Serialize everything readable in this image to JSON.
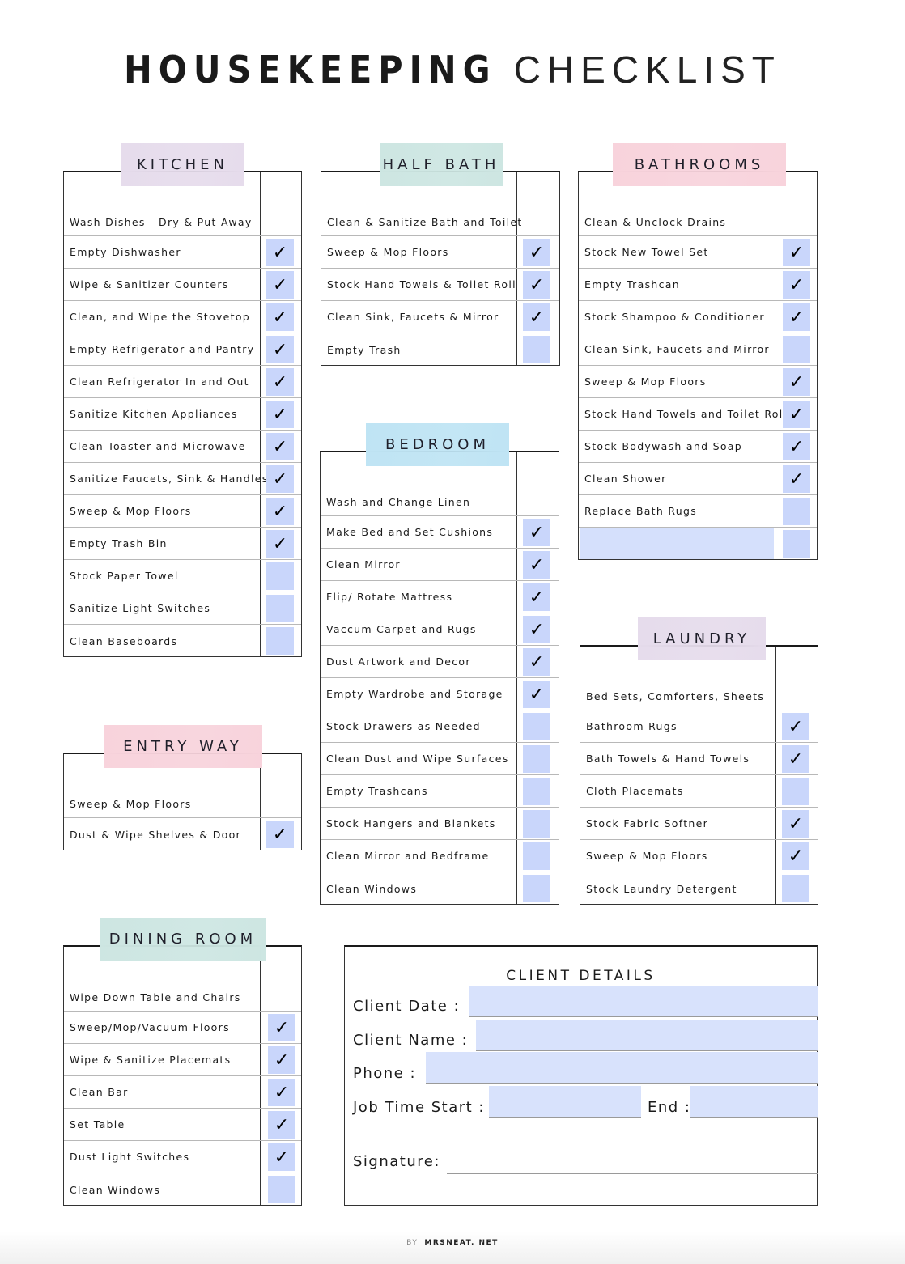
{
  "title": {
    "bold": "HOUSEKEEPING",
    "light": "CHECKLIST"
  },
  "colors": {
    "checkbox_fill": "#c9d6fb",
    "kitchen_header": "#e6dcec",
    "half_bath_header": "#cde6e2",
    "bathrooms_header": "#f8d3dc",
    "bedroom_header": "#bfe4f4",
    "laundry_header": "#e6dcec",
    "entry_way_header": "#f8d3dc",
    "dining_room_header": "#cde6e2"
  },
  "check_icon": "✓",
  "sections": {
    "kitchen": {
      "title": "KITCHEN",
      "items": [
        {
          "label": "Wash Dishes - Dry & Put Away",
          "has_box": false,
          "checked": false
        },
        {
          "label": "Empty Dishwasher",
          "has_box": true,
          "checked": true
        },
        {
          "label": "Wipe & Sanitizer Counters",
          "has_box": true,
          "checked": true
        },
        {
          "label": "Clean, and Wipe the Stovetop",
          "has_box": true,
          "checked": true
        },
        {
          "label": "Empty Refrigerator and Pantry",
          "has_box": true,
          "checked": true
        },
        {
          "label": "Clean Refrigerator In and Out",
          "has_box": true,
          "checked": true
        },
        {
          "label": "Sanitize Kitchen Appliances",
          "has_box": true,
          "checked": true
        },
        {
          "label": "Clean Toaster and Microwave",
          "has_box": true,
          "checked": true
        },
        {
          "label": "Sanitize Faucets, Sink & Handles",
          "has_box": true,
          "checked": true
        },
        {
          "label": "Sweep & Mop Floors",
          "has_box": true,
          "checked": true
        },
        {
          "label": "Empty Trash Bin",
          "has_box": true,
          "checked": true
        },
        {
          "label": "Stock Paper Towel",
          "has_box": true,
          "checked": false
        },
        {
          "label": "Sanitize Light Switches",
          "has_box": true,
          "checked": false
        },
        {
          "label": "Clean Baseboards",
          "has_box": true,
          "checked": false
        }
      ]
    },
    "half_bath": {
      "title": "HALF BATH",
      "items": [
        {
          "label": "Clean & Sanitize Bath and Toilet",
          "has_box": false,
          "checked": false
        },
        {
          "label": "Sweep & Mop Floors",
          "has_box": true,
          "checked": true
        },
        {
          "label": "Stock Hand Towels & Toilet Roll",
          "has_box": true,
          "checked": true
        },
        {
          "label": "Clean Sink, Faucets & Mirror",
          "has_box": true,
          "checked": true
        },
        {
          "label": "Empty Trash",
          "has_box": true,
          "checked": false
        }
      ]
    },
    "bathrooms": {
      "title": "BATHROOMS",
      "items": [
        {
          "label": "Clean & Unclock Drains",
          "has_box": false,
          "checked": false
        },
        {
          "label": "Stock New Towel Set",
          "has_box": true,
          "checked": true
        },
        {
          "label": "Empty Trashcan",
          "has_box": true,
          "checked": true
        },
        {
          "label": "Stock Shampoo & Conditioner",
          "has_box": true,
          "checked": true
        },
        {
          "label": "Clean Sink, Faucets and Mirror",
          "has_box": true,
          "checked": false
        },
        {
          "label": "Sweep & Mop Floors",
          "has_box": true,
          "checked": true
        },
        {
          "label": "Stock Hand Towels and Toilet Roll",
          "has_box": true,
          "checked": true
        },
        {
          "label": "Stock Bodywash and Soap",
          "has_box": true,
          "checked": true
        },
        {
          "label": "Clean Shower",
          "has_box": true,
          "checked": true
        },
        {
          "label": "Replace Bath Rugs",
          "has_box": true,
          "checked": false
        },
        {
          "label": "",
          "has_box": true,
          "checked": false,
          "blank_input": true
        }
      ]
    },
    "bedroom": {
      "title": "BEDROOM",
      "items": [
        {
          "label": "Wash and Change Linen",
          "has_box": false,
          "checked": false
        },
        {
          "label": "Make Bed and Set Cushions",
          "has_box": true,
          "checked": true
        },
        {
          "label": "Clean Mirror",
          "has_box": true,
          "checked": true
        },
        {
          "label": "Flip/ Rotate Mattress",
          "has_box": true,
          "checked": true
        },
        {
          "label": "Vaccum Carpet and Rugs",
          "has_box": true,
          "checked": true
        },
        {
          "label": "Dust Artwork and Decor",
          "has_box": true,
          "checked": true
        },
        {
          "label": "Empty Wardrobe and Storage",
          "has_box": true,
          "checked": true
        },
        {
          "label": "Stock Drawers as Needed",
          "has_box": true,
          "checked": false
        },
        {
          "label": "Clean Dust and Wipe Surfaces",
          "has_box": true,
          "checked": false
        },
        {
          "label": "Empty Trashcans",
          "has_box": true,
          "checked": false
        },
        {
          "label": "Stock Hangers and Blankets",
          "has_box": true,
          "checked": false
        },
        {
          "label": "Clean Mirror and Bedframe",
          "has_box": true,
          "checked": false
        },
        {
          "label": "Clean Windows",
          "has_box": true,
          "checked": false
        }
      ]
    },
    "laundry": {
      "title": "LAUNDRY",
      "items": [
        {
          "label": "Bed Sets, Comforters, Sheets",
          "has_box": false,
          "checked": false
        },
        {
          "label": "Bathroom Rugs",
          "has_box": true,
          "checked": true
        },
        {
          "label": "Bath Towels & Hand Towels",
          "has_box": true,
          "checked": true
        },
        {
          "label": "Cloth Placemats",
          "has_box": true,
          "checked": false
        },
        {
          "label": "Stock Fabric Softner",
          "has_box": true,
          "checked": true
        },
        {
          "label": "Sweep & Mop Floors",
          "has_box": true,
          "checked": true
        },
        {
          "label": "Stock Laundry Detergent",
          "has_box": true,
          "checked": false
        }
      ]
    },
    "entry_way": {
      "title": "ENTRY WAY",
      "items": [
        {
          "label": "Sweep & Mop Floors",
          "has_box": false,
          "checked": false
        },
        {
          "label": "Dust & Wipe Shelves & Door",
          "has_box": true,
          "checked": true
        }
      ]
    },
    "dining_room": {
      "title": "DINING ROOM",
      "items": [
        {
          "label": "Wipe Down Table and Chairs",
          "has_box": false,
          "checked": false
        },
        {
          "label": "Sweep/Mop/Vacuum Floors",
          "has_box": true,
          "checked": true
        },
        {
          "label": "Wipe & Sanitize Placemats",
          "has_box": true,
          "checked": true
        },
        {
          "label": "Clean Bar",
          "has_box": true,
          "checked": true
        },
        {
          "label": "Set Table",
          "has_box": true,
          "checked": true
        },
        {
          "label": "Dust Light Switches",
          "has_box": true,
          "checked": true
        },
        {
          "label": "Clean Windows",
          "has_box": true,
          "checked": false
        }
      ]
    }
  },
  "client_details": {
    "title": "CLIENT DETAILS",
    "date_label": "Client Date :",
    "date_value": "",
    "name_label": "Client Name :",
    "name_value": "",
    "phone_label": "Phone :",
    "phone_value": "",
    "start_label": "Job Time Start :",
    "start_value": "",
    "end_label": "End :",
    "end_value": "",
    "signature_label": "Signature:"
  },
  "footer": {
    "by": "BY",
    "site": "MRSNEAT. NET"
  }
}
